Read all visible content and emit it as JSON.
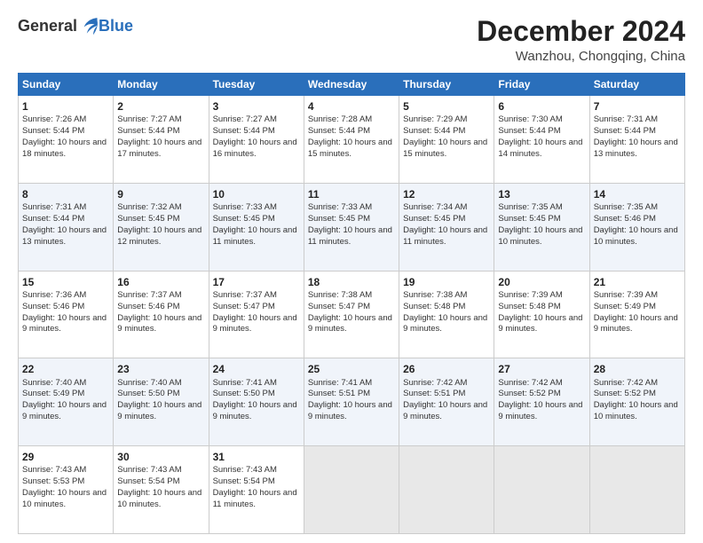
{
  "header": {
    "logo_general": "General",
    "logo_blue": "Blue",
    "month_title": "December 2024",
    "location": "Wanzhou, Chongqing, China"
  },
  "days_of_week": [
    "Sunday",
    "Monday",
    "Tuesday",
    "Wednesday",
    "Thursday",
    "Friday",
    "Saturday"
  ],
  "weeks": [
    [
      {
        "day": 1,
        "sunrise": "Sunrise: 7:26 AM",
        "sunset": "Sunset: 5:44 PM",
        "daylight": "Daylight: 10 hours and 18 minutes."
      },
      {
        "day": 2,
        "sunrise": "Sunrise: 7:27 AM",
        "sunset": "Sunset: 5:44 PM",
        "daylight": "Daylight: 10 hours and 17 minutes."
      },
      {
        "day": 3,
        "sunrise": "Sunrise: 7:27 AM",
        "sunset": "Sunset: 5:44 PM",
        "daylight": "Daylight: 10 hours and 16 minutes."
      },
      {
        "day": 4,
        "sunrise": "Sunrise: 7:28 AM",
        "sunset": "Sunset: 5:44 PM",
        "daylight": "Daylight: 10 hours and 15 minutes."
      },
      {
        "day": 5,
        "sunrise": "Sunrise: 7:29 AM",
        "sunset": "Sunset: 5:44 PM",
        "daylight": "Daylight: 10 hours and 15 minutes."
      },
      {
        "day": 6,
        "sunrise": "Sunrise: 7:30 AM",
        "sunset": "Sunset: 5:44 PM",
        "daylight": "Daylight: 10 hours and 14 minutes."
      },
      {
        "day": 7,
        "sunrise": "Sunrise: 7:31 AM",
        "sunset": "Sunset: 5:44 PM",
        "daylight": "Daylight: 10 hours and 13 minutes."
      }
    ],
    [
      {
        "day": 8,
        "sunrise": "Sunrise: 7:31 AM",
        "sunset": "Sunset: 5:44 PM",
        "daylight": "Daylight: 10 hours and 13 minutes."
      },
      {
        "day": 9,
        "sunrise": "Sunrise: 7:32 AM",
        "sunset": "Sunset: 5:45 PM",
        "daylight": "Daylight: 10 hours and 12 minutes."
      },
      {
        "day": 10,
        "sunrise": "Sunrise: 7:33 AM",
        "sunset": "Sunset: 5:45 PM",
        "daylight": "Daylight: 10 hours and 11 minutes."
      },
      {
        "day": 11,
        "sunrise": "Sunrise: 7:33 AM",
        "sunset": "Sunset: 5:45 PM",
        "daylight": "Daylight: 10 hours and 11 minutes."
      },
      {
        "day": 12,
        "sunrise": "Sunrise: 7:34 AM",
        "sunset": "Sunset: 5:45 PM",
        "daylight": "Daylight: 10 hours and 11 minutes."
      },
      {
        "day": 13,
        "sunrise": "Sunrise: 7:35 AM",
        "sunset": "Sunset: 5:45 PM",
        "daylight": "Daylight: 10 hours and 10 minutes."
      },
      {
        "day": 14,
        "sunrise": "Sunrise: 7:35 AM",
        "sunset": "Sunset: 5:46 PM",
        "daylight": "Daylight: 10 hours and 10 minutes."
      }
    ],
    [
      {
        "day": 15,
        "sunrise": "Sunrise: 7:36 AM",
        "sunset": "Sunset: 5:46 PM",
        "daylight": "Daylight: 10 hours and 9 minutes."
      },
      {
        "day": 16,
        "sunrise": "Sunrise: 7:37 AM",
        "sunset": "Sunset: 5:46 PM",
        "daylight": "Daylight: 10 hours and 9 minutes."
      },
      {
        "day": 17,
        "sunrise": "Sunrise: 7:37 AM",
        "sunset": "Sunset: 5:47 PM",
        "daylight": "Daylight: 10 hours and 9 minutes."
      },
      {
        "day": 18,
        "sunrise": "Sunrise: 7:38 AM",
        "sunset": "Sunset: 5:47 PM",
        "daylight": "Daylight: 10 hours and 9 minutes."
      },
      {
        "day": 19,
        "sunrise": "Sunrise: 7:38 AM",
        "sunset": "Sunset: 5:48 PM",
        "daylight": "Daylight: 10 hours and 9 minutes."
      },
      {
        "day": 20,
        "sunrise": "Sunrise: 7:39 AM",
        "sunset": "Sunset: 5:48 PM",
        "daylight": "Daylight: 10 hours and 9 minutes."
      },
      {
        "day": 21,
        "sunrise": "Sunrise: 7:39 AM",
        "sunset": "Sunset: 5:49 PM",
        "daylight": "Daylight: 10 hours and 9 minutes."
      }
    ],
    [
      {
        "day": 22,
        "sunrise": "Sunrise: 7:40 AM",
        "sunset": "Sunset: 5:49 PM",
        "daylight": "Daylight: 10 hours and 9 minutes."
      },
      {
        "day": 23,
        "sunrise": "Sunrise: 7:40 AM",
        "sunset": "Sunset: 5:50 PM",
        "daylight": "Daylight: 10 hours and 9 minutes."
      },
      {
        "day": 24,
        "sunrise": "Sunrise: 7:41 AM",
        "sunset": "Sunset: 5:50 PM",
        "daylight": "Daylight: 10 hours and 9 minutes."
      },
      {
        "day": 25,
        "sunrise": "Sunrise: 7:41 AM",
        "sunset": "Sunset: 5:51 PM",
        "daylight": "Daylight: 10 hours and 9 minutes."
      },
      {
        "day": 26,
        "sunrise": "Sunrise: 7:42 AM",
        "sunset": "Sunset: 5:51 PM",
        "daylight": "Daylight: 10 hours and 9 minutes."
      },
      {
        "day": 27,
        "sunrise": "Sunrise: 7:42 AM",
        "sunset": "Sunset: 5:52 PM",
        "daylight": "Daylight: 10 hours and 9 minutes."
      },
      {
        "day": 28,
        "sunrise": "Sunrise: 7:42 AM",
        "sunset": "Sunset: 5:52 PM",
        "daylight": "Daylight: 10 hours and 10 minutes."
      }
    ],
    [
      {
        "day": 29,
        "sunrise": "Sunrise: 7:43 AM",
        "sunset": "Sunset: 5:53 PM",
        "daylight": "Daylight: 10 hours and 10 minutes."
      },
      {
        "day": 30,
        "sunrise": "Sunrise: 7:43 AM",
        "sunset": "Sunset: 5:54 PM",
        "daylight": "Daylight: 10 hours and 10 minutes."
      },
      {
        "day": 31,
        "sunrise": "Sunrise: 7:43 AM",
        "sunset": "Sunset: 5:54 PM",
        "daylight": "Daylight: 10 hours and 11 minutes."
      },
      null,
      null,
      null,
      null
    ]
  ]
}
